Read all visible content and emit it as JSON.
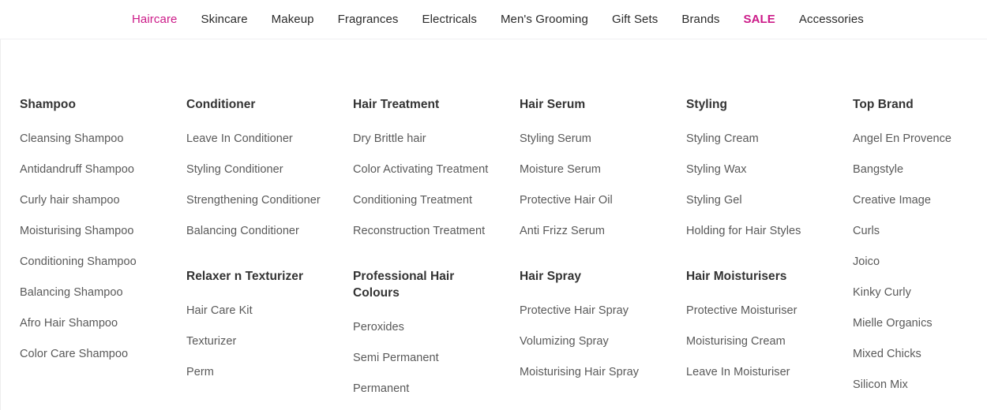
{
  "topnav": {
    "items": [
      {
        "label": "Haircare",
        "state": "active"
      },
      {
        "label": "Skincare",
        "state": "normal"
      },
      {
        "label": "Makeup",
        "state": "normal"
      },
      {
        "label": "Fragrances",
        "state": "normal"
      },
      {
        "label": "Electricals",
        "state": "normal"
      },
      {
        "label": "Men's Grooming",
        "state": "normal"
      },
      {
        "label": "Gift Sets",
        "state": "normal"
      },
      {
        "label": "Brands",
        "state": "normal"
      },
      {
        "label": "SALE",
        "state": "sale"
      },
      {
        "label": "Accessories",
        "state": "normal"
      }
    ]
  },
  "colors": {
    "accent": "#cc1a88",
    "heading": "#333333",
    "link": "#595959",
    "nav": "#2b2b2b",
    "background": "#ffffff",
    "divider": "#f0eff1"
  },
  "megamenu": {
    "columns": [
      {
        "groups": [
          {
            "heading": "Shampoo",
            "items": [
              "Cleansing Shampoo",
              "Antidandruff Shampoo",
              "Curly hair shampoo",
              "Moisturising Shampoo",
              "Conditioning Shampoo",
              "Balancing Shampoo",
              "Afro Hair Shampoo",
              "Color Care Shampoo"
            ]
          }
        ]
      },
      {
        "groups": [
          {
            "heading": "Conditioner",
            "items": [
              "Leave In Conditioner",
              "Styling Conditioner",
              "Strengthening Conditioner",
              "Balancing Conditioner"
            ]
          },
          {
            "heading": "Relaxer n Texturizer",
            "items": [
              "Hair Care Kit",
              "Texturizer",
              "Perm"
            ]
          }
        ]
      },
      {
        "groups": [
          {
            "heading": "Hair Treatment",
            "items": [
              "Dry Brittle hair",
              "Color Activating Treatment",
              "Conditioning Treatment",
              "Reconstruction Treatment"
            ]
          },
          {
            "heading": "Professional Hair Colours",
            "items": [
              "Peroxides",
              "Semi Permanent",
              "Permanent"
            ]
          }
        ]
      },
      {
        "groups": [
          {
            "heading": "Hair Serum",
            "items": [
              "Styling Serum",
              "Moisture Serum",
              "Protective Hair Oil",
              "Anti Frizz Serum"
            ]
          },
          {
            "heading": "Hair Spray",
            "items": [
              "Protective Hair Spray",
              "Volumizing Spray",
              "Moisturising Hair Spray"
            ]
          }
        ]
      },
      {
        "groups": [
          {
            "heading": "Styling",
            "items": [
              "Styling Cream",
              "Styling Wax",
              "Styling Gel",
              "Holding for Hair Styles"
            ]
          },
          {
            "heading": "Hair Moisturisers",
            "items": [
              "Protective Moisturiser",
              "Moisturising Cream",
              "Leave In Moisturiser"
            ]
          }
        ]
      },
      {
        "groups": [
          {
            "heading": "Top Brand",
            "items": [
              "Angel En Provence",
              "Bangstyle",
              "Creative Image",
              "Curls",
              "Joico",
              "Kinky Curly",
              "Mielle Organics",
              "Mixed Chicks",
              "Silicon Mix"
            ]
          }
        ]
      }
    ]
  }
}
